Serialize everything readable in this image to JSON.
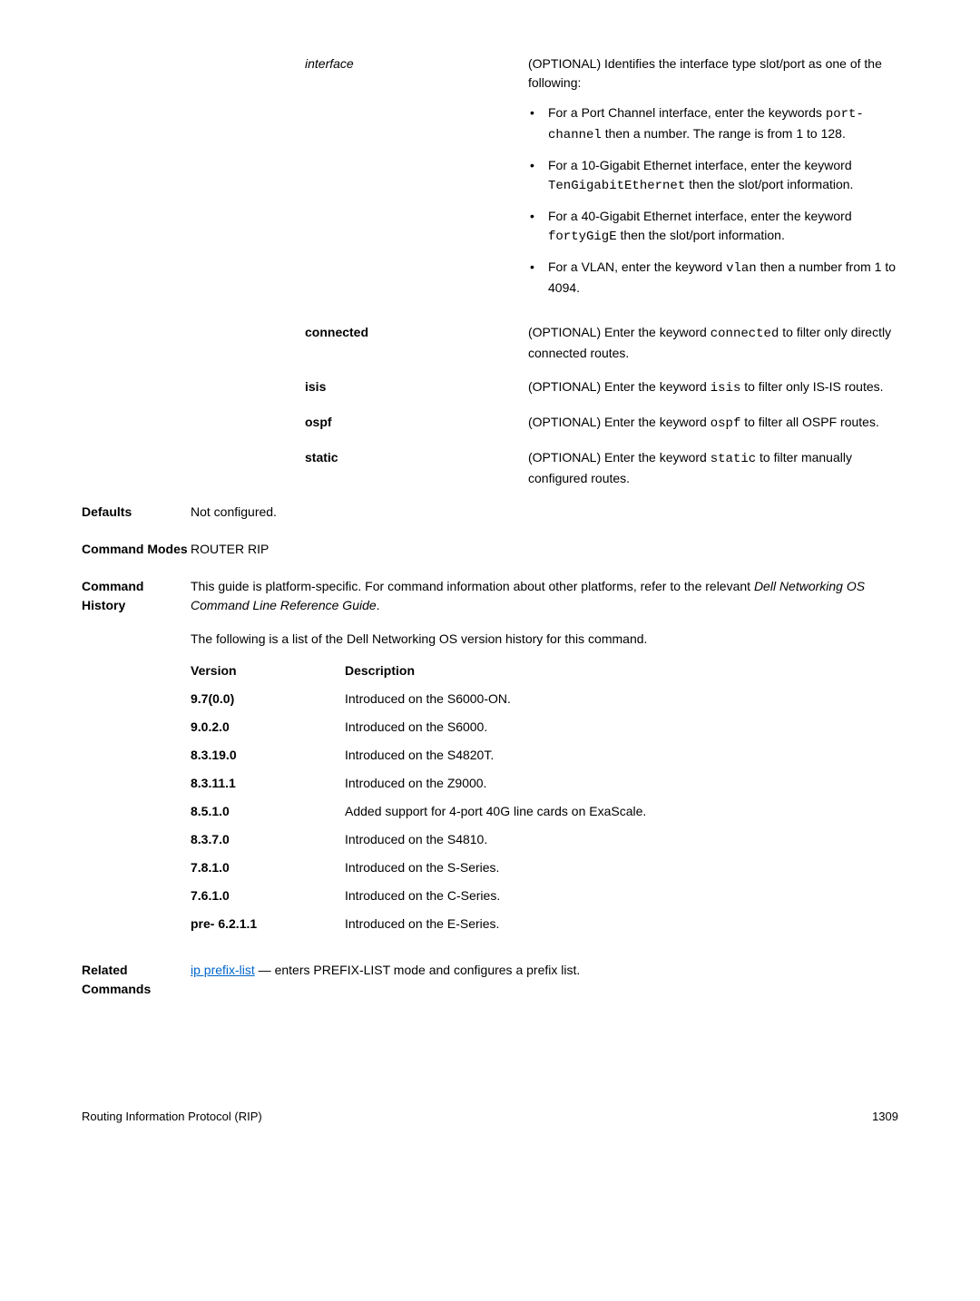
{
  "params": {
    "interface": {
      "label": "interface",
      "desc": "(OPTIONAL) Identifies the interface type slot/port as one of the following:",
      "bullets": [
        {
          "pre": "For a Port Channel interface, enter the keywords ",
          "code": "port-channel",
          "post": " then a number. The range is from 1 to 128."
        },
        {
          "pre": "For a 10-Gigabit Ethernet interface, enter the keyword ",
          "code": "TenGigabitEthernet",
          "post": " then the slot/port information."
        },
        {
          "pre": "For a 40-Gigabit Ethernet interface, enter the keyword ",
          "code": "fortyGigE",
          "post": " then the slot/port information."
        },
        {
          "pre": "For a VLAN, enter the keyword ",
          "code": "vlan",
          "post": " then a number from 1 to 4094."
        }
      ]
    },
    "connected": {
      "label": "connected",
      "pre": "(OPTIONAL) Enter the keyword ",
      "code": "connected",
      "post": " to filter only directly connected routes."
    },
    "isis": {
      "label": "isis",
      "pre": "(OPTIONAL) Enter the keyword ",
      "code": "isis",
      "post": " to filter only IS-IS routes."
    },
    "ospf": {
      "label": "ospf",
      "pre": "(OPTIONAL) Enter the keyword ",
      "code": "ospf",
      "post": " to filter all OSPF routes."
    },
    "static": {
      "label": "static",
      "pre": "(OPTIONAL) Enter the keyword ",
      "code": "static",
      "post": " to filter manually configured routes."
    }
  },
  "defaults": {
    "label": "Defaults",
    "value": "Not configured."
  },
  "command_modes": {
    "label": "Command Modes",
    "value": "ROUTER RIP"
  },
  "command_history": {
    "label": "Command History",
    "para1_pre": "This guide is platform-specific. For command information about other platforms, refer to the relevant ",
    "para1_italic": "Dell Networking OS Command Line Reference Guide",
    "para1_post": ".",
    "para2": "The following is a list of the Dell Networking OS version history for this command.",
    "header_version": "Version",
    "header_description": "Description",
    "rows": [
      {
        "version": "9.7(0.0)",
        "desc": "Introduced on the S6000-ON."
      },
      {
        "version": "9.0.2.0",
        "desc": "Introduced on the S6000."
      },
      {
        "version": "8.3.19.0",
        "desc": "Introduced on the S4820T."
      },
      {
        "version": "8.3.11.1",
        "desc": "Introduced on the Z9000."
      },
      {
        "version": "8.5.1.0",
        "desc": "Added support for 4-port 40G line cards on ExaScale."
      },
      {
        "version": "8.3.7.0",
        "desc": "Introduced on the S4810."
      },
      {
        "version": "7.8.1.0",
        "desc": "Introduced on the S-Series."
      },
      {
        "version": "7.6.1.0",
        "desc": "Introduced on the C-Series."
      },
      {
        "version": "pre- 6.2.1.1",
        "desc": "Introduced on the E-Series."
      }
    ]
  },
  "related": {
    "label": "Related Commands",
    "link": "ip prefix-list",
    "post": " — enters PREFIX-LIST mode and configures a prefix list."
  },
  "footer": {
    "left": "Routing Information Protocol (RIP)",
    "right": "1309"
  }
}
